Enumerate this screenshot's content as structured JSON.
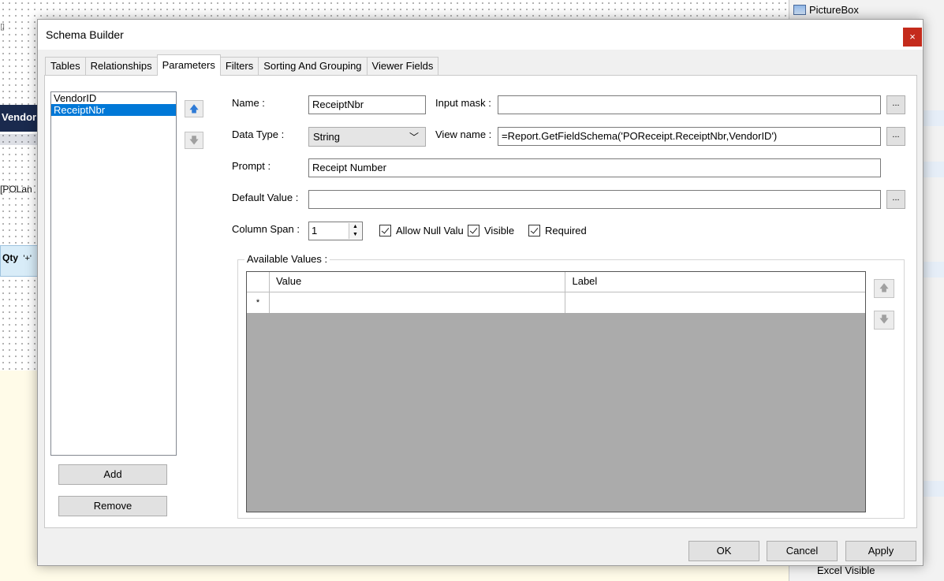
{
  "background": {
    "left_labels": {
      "vendor": "Vendor",
      "polan": "[POLan",
      "qty": "Qty",
      "qty_suffix": "'+'"
    },
    "right_panel": {
      "picturebox": "PictureBox",
      "excel_visible": "Excel Visible"
    }
  },
  "dialog": {
    "title": "Schema Builder",
    "close_glyph": "×",
    "tabs": [
      "Tables",
      "Relationships",
      "Parameters",
      "Filters",
      "Sorting And Grouping",
      "Viewer Fields"
    ],
    "active_tab": "Parameters",
    "parameters": {
      "list": [
        "VendorID",
        "ReceiptNbr"
      ],
      "selected": "ReceiptNbr",
      "move_up_icon": "arrow-up-icon",
      "move_down_icon": "arrow-down-icon",
      "add_label": "Add",
      "remove_label": "Remove"
    },
    "form": {
      "name_label": "Name :",
      "name_value": "ReceiptNbr",
      "input_mask_label": "Input mask :",
      "input_mask_value": "",
      "data_type_label": "Data Type :",
      "data_type_value": "String",
      "view_name_label": "View name :",
      "view_name_value": "=Report.GetFieldSchema('POReceipt.ReceiptNbr,VendorID')",
      "prompt_label": "Prompt :",
      "prompt_value": "Receipt Number",
      "default_value_label": "Default Value :",
      "default_value_value": "",
      "column_span_label": "Column Span :",
      "column_span_value": "1",
      "ellipsis": "...",
      "allow_null_label": "Allow Null Valu",
      "allow_null_checked": true,
      "visible_label": "Visible",
      "visible_checked": true,
      "required_label": "Required",
      "required_checked": true
    },
    "available_values": {
      "title": "Available Values :",
      "columns": [
        "Value",
        "Label"
      ],
      "new_row_marker": "*",
      "rows": []
    },
    "footer": {
      "ok": "OK",
      "cancel": "Cancel",
      "apply": "Apply"
    }
  }
}
